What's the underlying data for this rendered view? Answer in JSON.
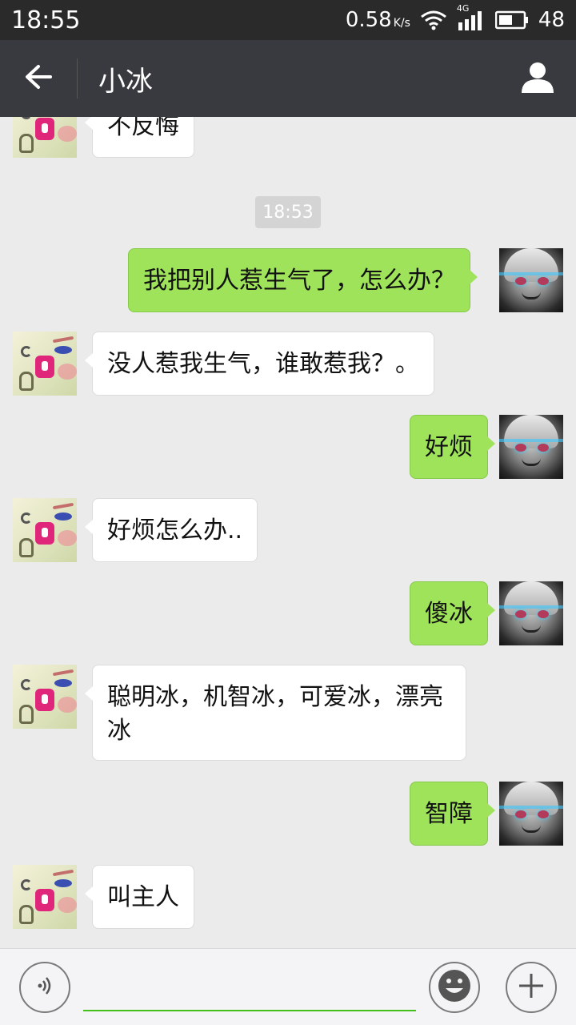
{
  "status_bar": {
    "time": "18:55",
    "net_speed": "0.58",
    "net_speed_unit": "K/s",
    "network_type": "4G",
    "battery": "48"
  },
  "header": {
    "title": "小冰",
    "back_icon": "arrow-left-icon",
    "profile_icon": "person-icon"
  },
  "chat": {
    "timestamp": "18:53",
    "messages": [
      {
        "side": "in",
        "text": "不反悔"
      },
      {
        "side": "out",
        "text": "我把别人惹生气了，怎么办？"
      },
      {
        "side": "in",
        "text": "没人惹我生气，谁敢惹我？。"
      },
      {
        "side": "out",
        "text": "好烦"
      },
      {
        "side": "in",
        "text": "好烦怎么办.."
      },
      {
        "side": "out",
        "text": "傻冰"
      },
      {
        "side": "in",
        "text": "聪明冰，机智冰，可爱冰，漂亮冰"
      },
      {
        "side": "out",
        "text": "智障"
      },
      {
        "side": "in",
        "text": "叫主人"
      }
    ]
  },
  "input_bar": {
    "voice_icon": "voice-icon",
    "emoji_icon": "emoji-icon",
    "plus_icon": "plus-icon",
    "text_value": ""
  },
  "colors": {
    "outgoing_bubble": "#9ee35a",
    "incoming_bubble": "#ffffff",
    "title_bar": "#393a3f",
    "status_bar": "#2a2a2a",
    "input_underline": "#45c01a"
  }
}
